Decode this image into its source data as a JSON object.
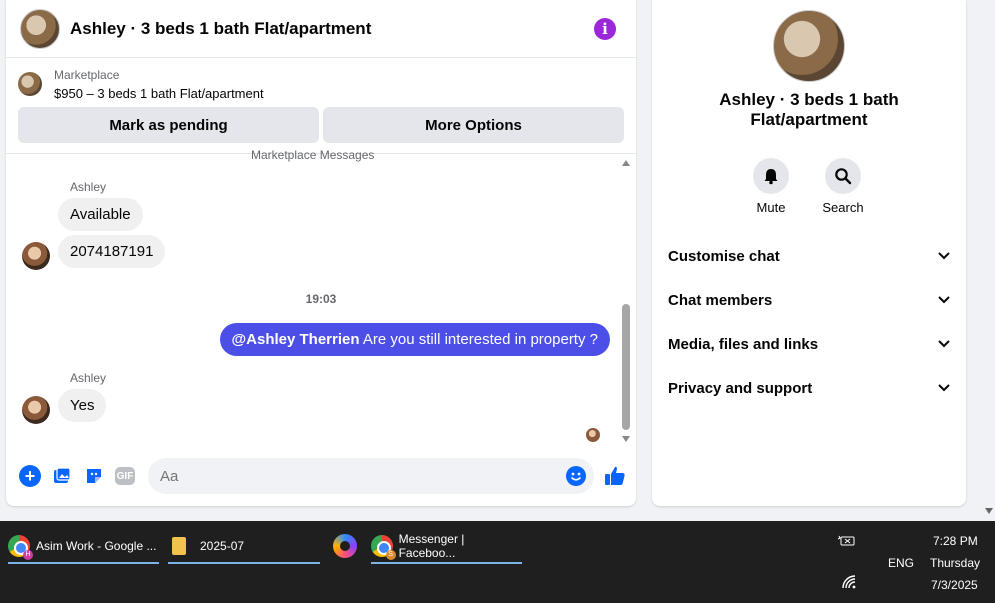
{
  "chat": {
    "title": "Ashley · 3 beds 1 bath Flat/apartment",
    "marketplace_label": "Marketplace",
    "marketplace_listing": "$950 – 3 beds 1 bath Flat/apartment",
    "mark_pending": "Mark as pending",
    "more_options": "More Options",
    "cut_label": "Marketplace Messages",
    "messages": {
      "sender1": "Ashley",
      "msg1": "Available",
      "msg2": "2074187191",
      "time": "19:03",
      "out_mention": "@Ashley Therrien",
      "out_text": " Are you still interested in property ?",
      "sender2": "Ashley",
      "msg3": "Yes"
    },
    "composer_placeholder": "Aa",
    "gif_label": "GIF"
  },
  "info_panel": {
    "name": "Ashley · 3 beds 1 bath Flat/apartment",
    "mute_label": "Mute",
    "search_label": "Search",
    "sections": [
      "Customise chat",
      "Chat members",
      "Media, files and links",
      "Privacy and support"
    ]
  },
  "taskbar": {
    "tasks": [
      "Asim Work - Google ...",
      "2025-07",
      "Messenger | Faceboo..."
    ],
    "badge1": "H",
    "badge3": "S",
    "lang": "ENG",
    "time": "7:28 PM",
    "day": "Thursday",
    "date": "7/3/2025"
  },
  "colors": {
    "accent": "#0866ff",
    "outgoing_bubble": "#4b4fe8",
    "info_icon": "#9c27d9"
  }
}
